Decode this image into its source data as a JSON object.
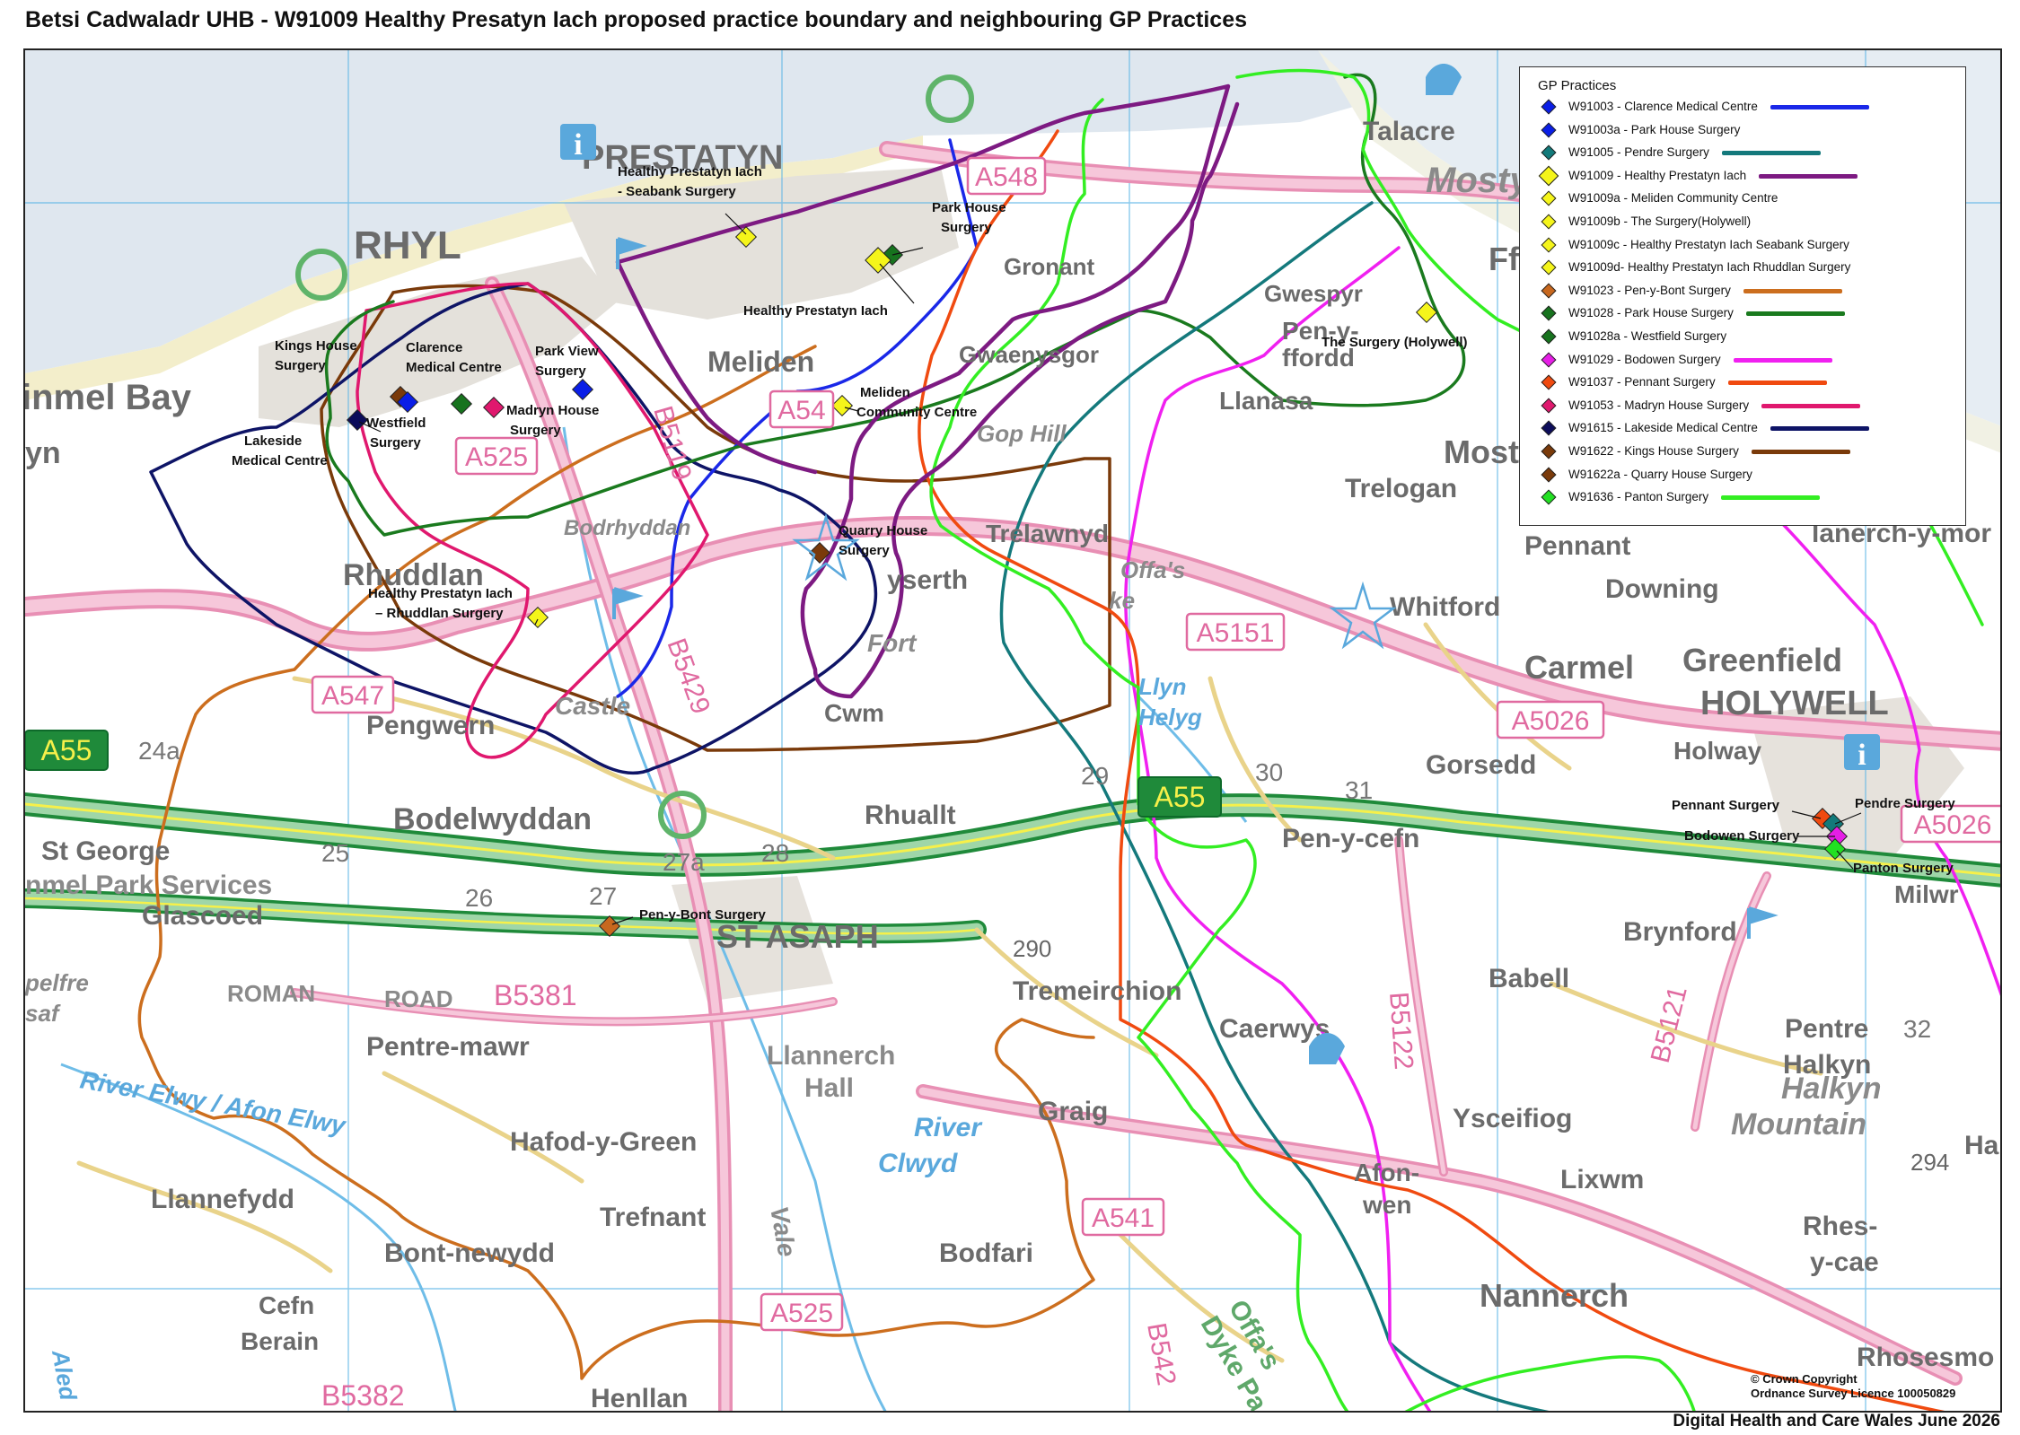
{
  "title": "Betsi Cadwaladr UHB - W91009 Healthy Presatyn Iach proposed practice boundary and neighbouring GP Practices",
  "footer": "Digital Health and Care Wales June 2026",
  "copyright": [
    "© Crown Copyright",
    "Ordnance Survey Licence 100050829"
  ],
  "legend": {
    "title": "GP Practices",
    "items": [
      {
        "code": "W91003 - Clarence Medical Centre",
        "symbol": "#0a1ee6",
        "line": "#1a28e8"
      },
      {
        "code": "W91003a - Park House Surgery",
        "symbol": "#0a1ee6",
        "line": ""
      },
      {
        "code": "W91005 - Pendre Surgery",
        "symbol": "#127a7a",
        "line": "#14797c"
      },
      {
        "code": "W91009 - Healthy Prestatyn Iach",
        "symbol": "#f5f51a",
        "line": "#7d1a82",
        "big": true
      },
      {
        "code": "W91009a - Meliden Community Centre",
        "symbol": "#f5f51a",
        "line": ""
      },
      {
        "code": "W91009b - The Surgery(Holywell)",
        "symbol": "#f5f51a",
        "line": ""
      },
      {
        "code": "W91009c - Healthy Prestatyn Iach Seabank Surgery",
        "symbol": "#f5f51a",
        "line": ""
      },
      {
        "code": "W91009d- Healthy Prestatyn Iach Rhuddlan Surgery",
        "symbol": "#f5f51a",
        "line": ""
      },
      {
        "code": "W91023 - Pen-y-Bont Surgery",
        "symbol": "#c8681e",
        "line": "#cc6e1e"
      },
      {
        "code": "W91028 - Park House Surgery",
        "symbol": "#17731e",
        "line": "#1a7a1e"
      },
      {
        "code": "W91028a - Westfield Surgery",
        "symbol": "#17731e",
        "line": ""
      },
      {
        "code": "W91029 - Bodowen Surgery",
        "symbol": "#e61ee6",
        "line": "#f020f0"
      },
      {
        "code": "W91037 - Pennant Surgery",
        "symbol": "#f04a0f",
        "line": "#f04a10"
      },
      {
        "code": "W91053 - Madryn House Surgery",
        "symbol": "#e0186e",
        "line": "#e0186e"
      },
      {
        "code": "W91615 - Lakeside Medical Centre",
        "symbol": "#0c0c5a",
        "line": "#0e1466"
      },
      {
        "code": "W91622 - Kings House Surgery",
        "symbol": "#7a3a0a",
        "line": "#7a3a0a"
      },
      {
        "code": "W91622a - Quarry House Surgery",
        "symbol": "#7a3a0a",
        "line": ""
      },
      {
        "code": "W91636 - Panton Surgery",
        "symbol": "#22e022",
        "line": "#33ee22"
      }
    ]
  },
  "practice_labels": {
    "seabank": [
      "Healthy Prestatyn Iach",
      "- Seabank Surgery"
    ],
    "park_house": [
      "Park House",
      "Surgery"
    ],
    "prestatyn_iach": "Healthy Prestatyn Iach",
    "kings_house": [
      "Kings House",
      "Surgery"
    ],
    "clarence": [
      "Clarence",
      "Medical Centre"
    ],
    "park_view": [
      "Park View",
      "Surgery"
    ],
    "westfield": [
      "Westfield",
      "Surgery"
    ],
    "madryn": [
      "Madryn House",
      "Surgery"
    ],
    "lakeside": [
      "Lakeside",
      "Medical Centre"
    ],
    "meliden": [
      "Meliden",
      "Community Centre"
    ],
    "quarry": [
      "Quarry House",
      "Surgery"
    ],
    "rhuddlan": [
      "Healthy Prestatyn Iach",
      "– Rhuddlan Surgery"
    ],
    "holywell": "The Surgery (Holywell)",
    "pen_y_bont": "Pen-y-Bont Surgery",
    "pennant": "Pennant Surgery",
    "pendre": "Pendre Surgery",
    "bodowen": "Bodowen Surgery",
    "panton": "Panton Surgery"
  },
  "places": {
    "prestatyn": "PRESTATYN",
    "rhyl": "RHYL",
    "kinmel_bay": "inmel Bay",
    "yn": "yn",
    "meliden": "Meliden",
    "gronant": "Gronant",
    "gwaenysgor": "Gwaenysgor",
    "gop_hill": "Gop Hill",
    "talacre": "Talacre",
    "mostyn": "Mostyn",
    "ffyn": "Ffyn",
    "gwespyr": "Gwespyr",
    "pen_y_ffordd": "Pen-y-\nffordd",
    "llanasa": "Llanasa",
    "mostyn2": "Mostyn",
    "trelogan": "Trelogan",
    "trelawnyd": "Trelawnyd",
    "rhuddlan": "Rhuddlan",
    "bodrhyddan": "Bodrhyddan",
    "dyserth": "yserth",
    "fort": "Fort",
    "castle": "Castle",
    "cwm": "Cwm",
    "pengwern": "Pengwern",
    "bodelwyddan": "Bodelwyddan",
    "st_george": "St George",
    "kinmel_park": "nmel Park Services",
    "glascoed": "Glascoed",
    "rhuallt": "Rhuallt",
    "st_asaph": "ST ASAPH",
    "pennant": "Pennant",
    "downing": "Downing",
    "whitford": "Whitford",
    "carmel": "Carmel",
    "greenfield": "Greenfield",
    "holywell": "HOLYWELL",
    "holway": "Holway",
    "gorsedd": "Gorsedd",
    "pen_y_cefn": "Pen-y-cefn",
    "brynford": "Brynford",
    "babell": "Babell",
    "tremeirchion": "Tremeirchion",
    "caerwys": "Caerwys",
    "pentre_mawr": "Pentre-mawr",
    "roman": "ROMAN",
    "road": "ROAD",
    "llannerch": "Llannerch",
    "hall": "Hall",
    "hafod_y_green": "Hafod-y-Green",
    "llannefydd": "Llannefydd",
    "trefnant": "Trefnant",
    "graig": "Graig",
    "ysceifiog": "Ysceifiog",
    "lixwm": "Lixwm",
    "bont_newydd": "Bont-newydd",
    "bodfari": "Bodfari",
    "cefn_berain": "Cefn\nBerain",
    "henllan": "Henllan",
    "nannerch": "Nannerch",
    "rhes_y_cae": "Rhes-\ny-cae",
    "afon_wen": "Afon-\nwen",
    "pentre_halkyn": "Pentre\nHalkyn",
    "halkyn_mountain": "Halkyn\nMountain",
    "rhosesmo": "Rhosesmo",
    "milwr": "Milwr",
    "halk": "Halk",
    "llanerch_y_mor": "lanerch-y-mor",
    "river_elwy": "River Elwy / Afon Elwy",
    "river_clwyd": "River\nClwyd",
    "aled": "Aled",
    "offas_dyke": "Offa's\nDyke Pa",
    "offas": "Offa's\n  ke",
    "llyn_helyg": "Llyn\nHelyg",
    "ffelfre": "pelfre\nsaf",
    "vale": "Vale"
  },
  "roads": {
    "a548": "A548",
    "a547": "A547",
    "a525": "A525",
    "a5151": "A5151",
    "a5026": "A5026",
    "a5026b": "A5026",
    "a55": "A55",
    "a55b": "A55",
    "a541": "A541",
    "a525b": "A525",
    "b5381": "B5381",
    "b5382": "B5382",
    "b5122": "B5122",
    "b5121": "B5121",
    "b5429": "B5429",
    "b5119": "B5119",
    "b542": "B542",
    "a54": "A54"
  },
  "junctions": [
    "24a",
    "25",
    "26",
    "27",
    "27a",
    "28",
    "29",
    "30",
    "31",
    "32"
  ],
  "spot_heights": [
    "290",
    "294"
  ]
}
